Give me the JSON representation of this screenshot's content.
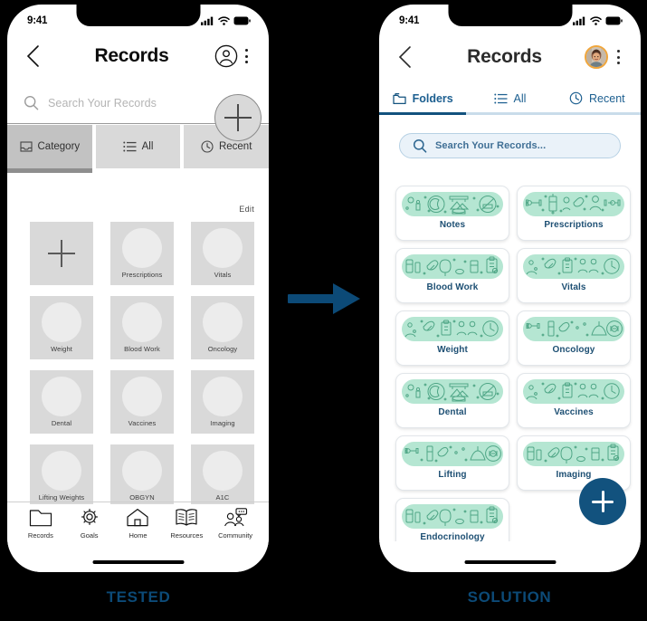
{
  "colors": {
    "background": "#000000",
    "brand": "#12527e",
    "brand_text": "#1c5f90",
    "mint": "#b5e6d2",
    "mint_line": "#4fa686",
    "avatar_ring": "#f0a63c",
    "wire_gray": "#d9d9d9",
    "wire_gray_active": "#c2c2c2",
    "caption_blue": "#0c4a77"
  },
  "captions": {
    "left": "TESTED",
    "right": "SOLUTION"
  },
  "arrow": {
    "name": "right-arrow",
    "color": "#0c4a77"
  },
  "left_phone": {
    "status_bar": {
      "time": "9:41",
      "icons": [
        "cellular-signal-icon",
        "wifi-icon",
        "battery-icon"
      ]
    },
    "header": {
      "back_icon": "chevron-left-icon",
      "title": "Records",
      "profile_icon": "person-circle-icon",
      "menu_icon": "kebab-menu-icon"
    },
    "search": {
      "icon": "search-icon",
      "placeholder": "Search Your Records",
      "value": ""
    },
    "add_button": {
      "label": "+",
      "icon": "plus-icon"
    },
    "tabs": [
      {
        "label": "Category",
        "icon": "inbox-icon",
        "active": true
      },
      {
        "label": "All",
        "icon": "list-icon",
        "active": false
      },
      {
        "label": "Recent",
        "icon": "clock-icon",
        "active": false
      }
    ],
    "edit_label": "Edit",
    "grid": [
      {
        "label": "",
        "type": "add",
        "icon": "plus-icon"
      },
      {
        "label": "Prescriptions",
        "type": "category"
      },
      {
        "label": "Vitals",
        "type": "category"
      },
      {
        "label": "Weight",
        "type": "category"
      },
      {
        "label": "Blood Work",
        "type": "category"
      },
      {
        "label": "Oncology",
        "type": "category"
      },
      {
        "label": "Dental",
        "type": "category"
      },
      {
        "label": "Vaccines",
        "type": "category"
      },
      {
        "label": "Imaging",
        "type": "category"
      },
      {
        "label": "Lifting Weights",
        "type": "category"
      },
      {
        "label": "OBGYN",
        "type": "category"
      },
      {
        "label": "A1C",
        "type": "category"
      }
    ],
    "bottom_nav": [
      {
        "label": "Records",
        "icon": "folder-icon"
      },
      {
        "label": "Goals",
        "icon": "gear-icon"
      },
      {
        "label": "Home",
        "icon": "home-icon"
      },
      {
        "label": "Resources",
        "icon": "book-icon"
      },
      {
        "label": "Community",
        "icon": "people-chat-icon"
      }
    ]
  },
  "right_phone": {
    "status_bar": {
      "time": "9:41",
      "icons": [
        "cellular-signal-icon",
        "wifi-icon",
        "battery-icon"
      ]
    },
    "header": {
      "back_icon": "chevron-left-icon",
      "title": "Records",
      "avatar": "user-avatar-photo",
      "menu_icon": "kebab-menu-icon"
    },
    "tabs": [
      {
        "label": "Folders",
        "icon": "folder-icon",
        "active": true
      },
      {
        "label": "All",
        "icon": "list-icon",
        "active": false
      },
      {
        "label": "Recent",
        "icon": "clock-icon",
        "active": false
      }
    ],
    "search": {
      "icon": "search-icon",
      "placeholder": "Search Your Records...",
      "value": ""
    },
    "folders": [
      {
        "label": "Notes"
      },
      {
        "label": "Prescriptions"
      },
      {
        "label": "Blood Work"
      },
      {
        "label": "Vitals"
      },
      {
        "label": "Weight"
      },
      {
        "label": "Oncology"
      },
      {
        "label": "Dental"
      },
      {
        "label": "Vaccines"
      },
      {
        "label": "Lifting"
      },
      {
        "label": "Imaging"
      },
      {
        "label": "Endocrinology"
      }
    ],
    "fab": {
      "label": "+",
      "icon": "plus-icon"
    }
  }
}
